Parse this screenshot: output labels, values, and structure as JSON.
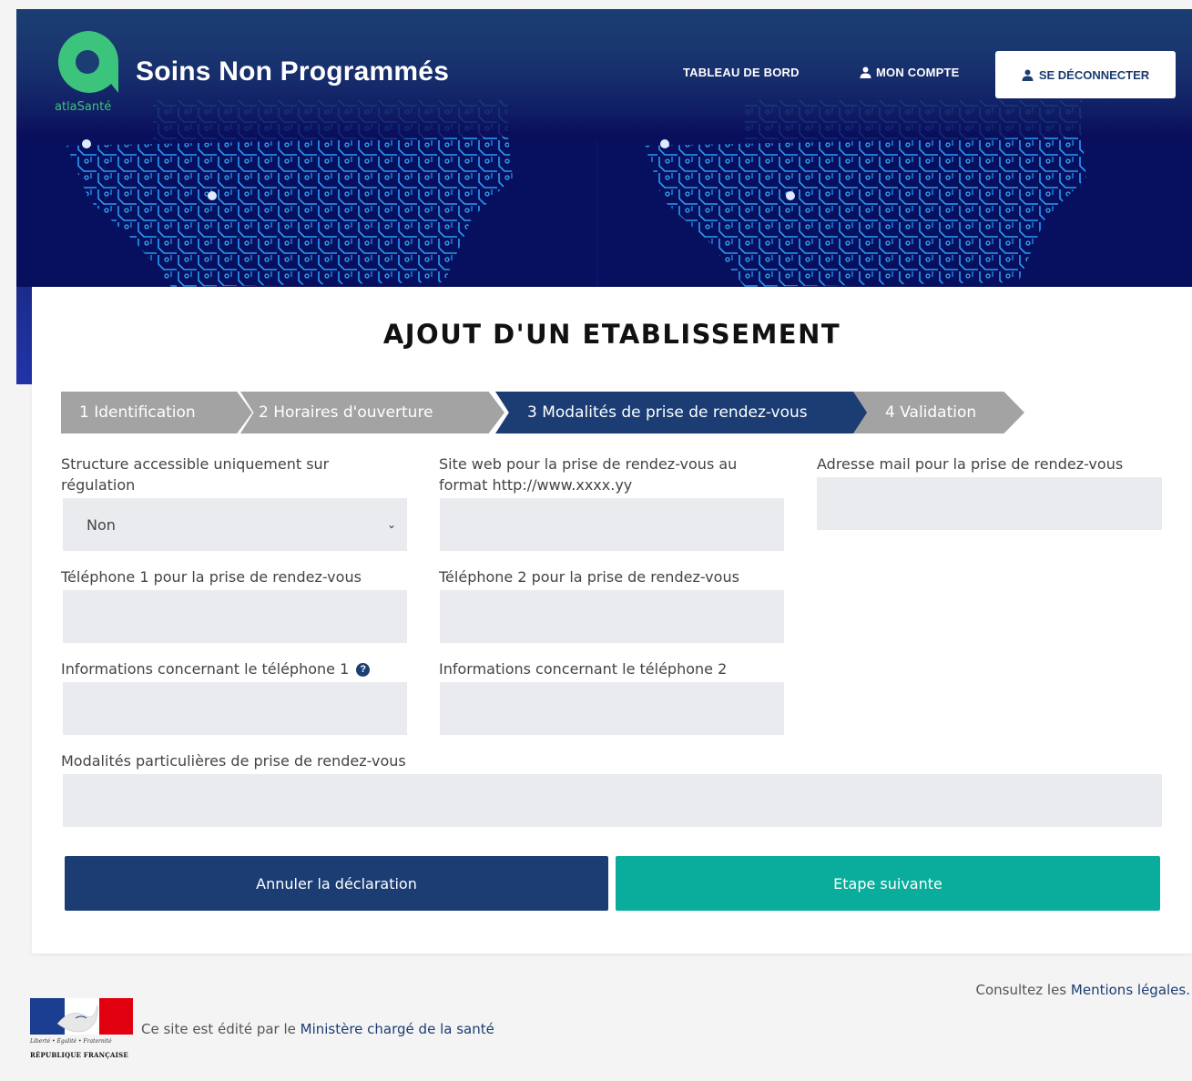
{
  "header": {
    "logo_text": "atlaSanté",
    "app_title": "Soins Non Programmés",
    "nav": {
      "dashboard": "TABLEAU DE BORD",
      "account": "MON COMPTE",
      "logout": "SE DÉCONNECTER"
    }
  },
  "page": {
    "title": "AJOUT D'UN ETABLISSEMENT"
  },
  "stepper": {
    "steps": [
      {
        "label": "1 Identification",
        "state": "done"
      },
      {
        "label": "2 Horaires d'ouverture",
        "state": "done"
      },
      {
        "label": "3 Modalités de prise de rendez-vous",
        "state": "active"
      },
      {
        "label": "4 Validation",
        "state": "todo"
      }
    ]
  },
  "form": {
    "regulation_label": "Structure accessible uniquement sur régulation",
    "regulation_value": "Non",
    "website_label": "Site web pour la prise de rendez-vous au format http://www.xxxx.yy",
    "website_value": "",
    "email_label": "Adresse mail pour la prise de rendez-vous",
    "email_value": "",
    "phone1_label": "Téléphone 1 pour la prise de rendez-vous",
    "phone1_value": "",
    "phone2_label": "Téléphone 2 pour la prise de rendez-vous",
    "phone2_value": "",
    "phone1_info_label": "Informations concernant le téléphone 1",
    "phone1_info_value": "",
    "phone2_info_label": "Informations concernant le téléphone 2",
    "phone2_info_value": "",
    "special_label": "Modalités particulières de prise de rendez-vous",
    "special_value": ""
  },
  "actions": {
    "cancel": "Annuler la déclaration",
    "next": "Etape suivante"
  },
  "footer": {
    "legal_prefix": "Consultez les ",
    "legal_link": "Mentions légales.",
    "editor_prefix": "Ce site est édité par le ",
    "editor_link": "Ministère chargé de la santé",
    "rf_motto": "Liberté • Égalité • Fraternité",
    "rf_name": "RÉPUBLIQUE FRANÇAISE"
  },
  "colors": {
    "primary": "#1b3d73",
    "accent": "#0aac9b",
    "step_inactive": "#a3a3a3",
    "logo_green": "#3cc47c"
  }
}
